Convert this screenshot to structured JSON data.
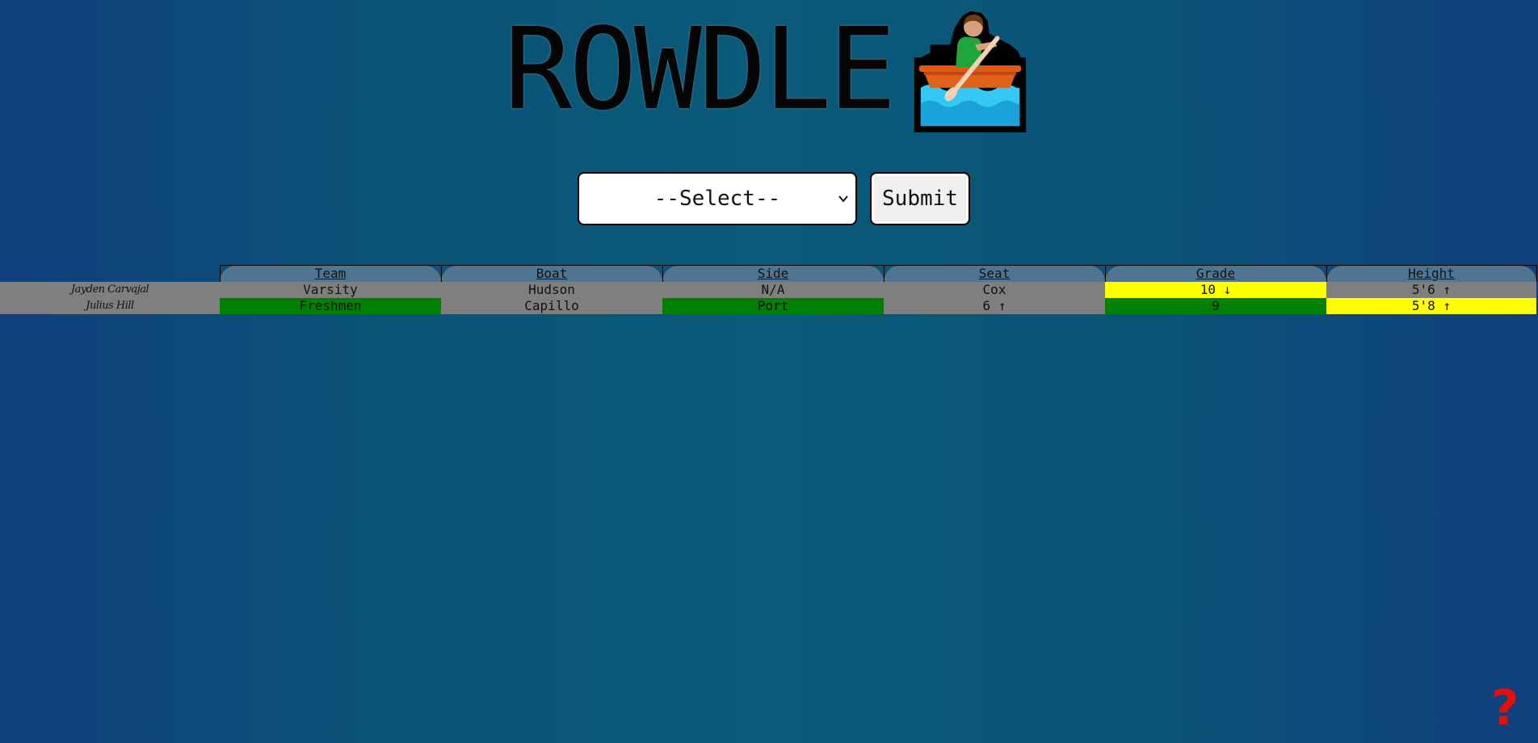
{
  "header": {
    "title": "ROWDLE",
    "logo_icon": "person-rowing-boat-icon"
  },
  "controls": {
    "select_value": "--Select--",
    "submit_label": "Submit"
  },
  "table": {
    "columns": [
      "Team",
      "Boat",
      "Side",
      "Seat",
      "Grade",
      "Height"
    ],
    "rows": [
      {
        "name": "Jayden Carvajal",
        "cells": [
          {
            "text": "Varsity",
            "status": "gray"
          },
          {
            "text": "Hudson",
            "status": "gray"
          },
          {
            "text": "N/A",
            "status": "gray"
          },
          {
            "text": "Cox",
            "status": "gray"
          },
          {
            "text": "10 ↓",
            "status": "yellow"
          },
          {
            "text": "5'6 ↑",
            "status": "gray"
          }
        ]
      },
      {
        "name": "Julius Hill",
        "cells": [
          {
            "text": "Freshmen",
            "status": "green"
          },
          {
            "text": "Capillo",
            "status": "gray"
          },
          {
            "text": "Port",
            "status": "green"
          },
          {
            "text": "6 ↑",
            "status": "gray"
          },
          {
            "text": "9",
            "status": "green"
          },
          {
            "text": "5'8 ↑",
            "status": "yellow"
          }
        ]
      }
    ]
  },
  "colors": {
    "correct": "#007f00",
    "close": "#ffff00",
    "wrong": "#7f7f7f",
    "help": "#e0100c"
  },
  "help": {
    "label": "?",
    "icon": "question-mark-icon"
  }
}
